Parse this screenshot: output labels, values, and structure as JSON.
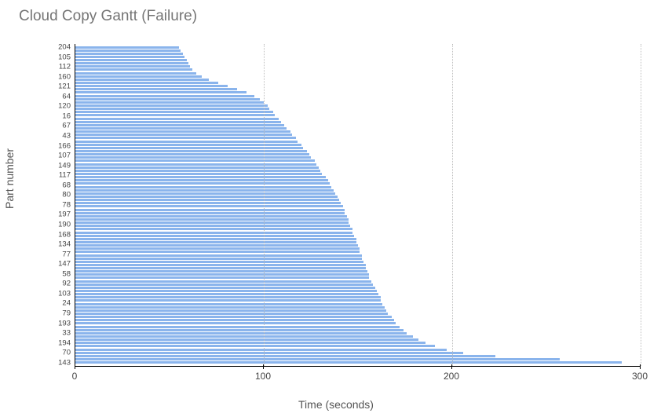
{
  "chart_data": {
    "type": "bar",
    "orientation": "horizontal",
    "title": "Cloud Copy Gantt (Failure)",
    "xlabel": "Time (seconds)",
    "ylabel": "Part number",
    "x_ticks": [
      0,
      100,
      200,
      300
    ],
    "xlim": [
      0,
      300
    ],
    "bar_color": "#8ab4ec",
    "y_tick_labels": [
      "204",
      "105",
      "112",
      "160",
      "121",
      "64",
      "120",
      "16",
      "67",
      "43",
      "166",
      "107",
      "149",
      "117",
      "68",
      "80",
      "78",
      "197",
      "190",
      "168",
      "134",
      "77",
      "147",
      "58",
      "92",
      "103",
      "24",
      "79",
      "193",
      "33",
      "194",
      "70",
      "143"
    ],
    "series": [
      {
        "part": "204",
        "value": 55
      },
      {
        "part": "",
        "value": 56
      },
      {
        "part": "",
        "value": 57
      },
      {
        "part": "105",
        "value": 58
      },
      {
        "part": "",
        "value": 59
      },
      {
        "part": "",
        "value": 60
      },
      {
        "part": "112",
        "value": 61
      },
      {
        "part": "",
        "value": 62
      },
      {
        "part": "",
        "value": 64
      },
      {
        "part": "160",
        "value": 67
      },
      {
        "part": "",
        "value": 71
      },
      {
        "part": "",
        "value": 76
      },
      {
        "part": "121",
        "value": 81
      },
      {
        "part": "",
        "value": 86
      },
      {
        "part": "",
        "value": 91
      },
      {
        "part": "64",
        "value": 95
      },
      {
        "part": "",
        "value": 98
      },
      {
        "part": "",
        "value": 100
      },
      {
        "part": "120",
        "value": 102
      },
      {
        "part": "",
        "value": 103
      },
      {
        "part": "",
        "value": 105
      },
      {
        "part": "16",
        "value": 106
      },
      {
        "part": "",
        "value": 108
      },
      {
        "part": "",
        "value": 109
      },
      {
        "part": "67",
        "value": 111
      },
      {
        "part": "",
        "value": 112
      },
      {
        "part": "",
        "value": 114
      },
      {
        "part": "43",
        "value": 115
      },
      {
        "part": "",
        "value": 117
      },
      {
        "part": "",
        "value": 118
      },
      {
        "part": "166",
        "value": 120
      },
      {
        "part": "",
        "value": 121
      },
      {
        "part": "",
        "value": 123
      },
      {
        "part": "107",
        "value": 124
      },
      {
        "part": "",
        "value": 125
      },
      {
        "part": "",
        "value": 127
      },
      {
        "part": "149",
        "value": 128
      },
      {
        "part": "",
        "value": 129
      },
      {
        "part": "",
        "value": 130
      },
      {
        "part": "117",
        "value": 131
      },
      {
        "part": "",
        "value": 133
      },
      {
        "part": "",
        "value": 134
      },
      {
        "part": "68",
        "value": 135
      },
      {
        "part": "",
        "value": 136
      },
      {
        "part": "",
        "value": 137
      },
      {
        "part": "80",
        "value": 138
      },
      {
        "part": "",
        "value": 139
      },
      {
        "part": "",
        "value": 140
      },
      {
        "part": "78",
        "value": 141
      },
      {
        "part": "",
        "value": 142
      },
      {
        "part": "",
        "value": 143
      },
      {
        "part": "197",
        "value": 143
      },
      {
        "part": "",
        "value": 144
      },
      {
        "part": "",
        "value": 145
      },
      {
        "part": "190",
        "value": 145
      },
      {
        "part": "",
        "value": 146
      },
      {
        "part": "",
        "value": 147
      },
      {
        "part": "168",
        "value": 147
      },
      {
        "part": "",
        "value": 148
      },
      {
        "part": "",
        "value": 149
      },
      {
        "part": "134",
        "value": 149
      },
      {
        "part": "",
        "value": 150
      },
      {
        "part": "",
        "value": 151
      },
      {
        "part": "77",
        "value": 151
      },
      {
        "part": "",
        "value": 152
      },
      {
        "part": "",
        "value": 152
      },
      {
        "part": "147",
        "value": 153
      },
      {
        "part": "",
        "value": 154
      },
      {
        "part": "",
        "value": 154
      },
      {
        "part": "58",
        "value": 155
      },
      {
        "part": "",
        "value": 156
      },
      {
        "part": "",
        "value": 156
      },
      {
        "part": "92",
        "value": 157
      },
      {
        "part": "",
        "value": 158
      },
      {
        "part": "",
        "value": 159
      },
      {
        "part": "103",
        "value": 160
      },
      {
        "part": "",
        "value": 161
      },
      {
        "part": "",
        "value": 162
      },
      {
        "part": "24",
        "value": 162
      },
      {
        "part": "",
        "value": 163
      },
      {
        "part": "",
        "value": 164
      },
      {
        "part": "79",
        "value": 165
      },
      {
        "part": "",
        "value": 166
      },
      {
        "part": "",
        "value": 168
      },
      {
        "part": "193",
        "value": 169
      },
      {
        "part": "",
        "value": 170
      },
      {
        "part": "",
        "value": 172
      },
      {
        "part": "33",
        "value": 174
      },
      {
        "part": "",
        "value": 176
      },
      {
        "part": "",
        "value": 179
      },
      {
        "part": "194",
        "value": 182
      },
      {
        "part": "",
        "value": 186
      },
      {
        "part": "",
        "value": 191
      },
      {
        "part": "70",
        "value": 197
      },
      {
        "part": "",
        "value": 206
      },
      {
        "part": "",
        "value": 223
      },
      {
        "part": "143",
        "value": 257
      },
      {
        "part": "",
        "value": 290
      }
    ]
  }
}
